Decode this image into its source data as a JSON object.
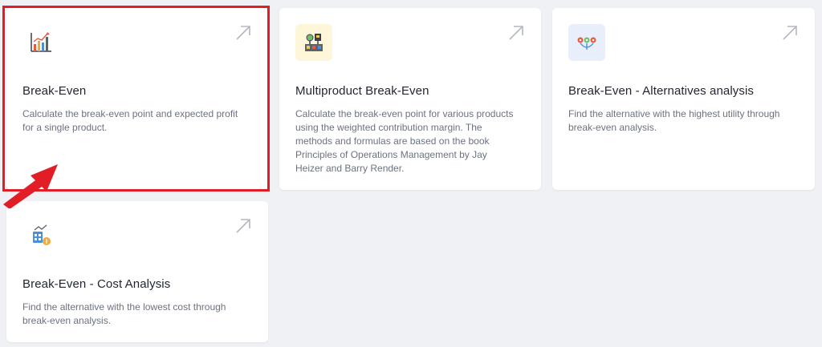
{
  "cards": [
    {
      "title": "Break-Even",
      "icon": "bar-chart-growth-icon",
      "desc": [
        "Calculate the break-even point and expected profit",
        "for a single product."
      ]
    },
    {
      "title": "Multiproduct Break-Even",
      "icon": "production-line-icon",
      "desc": [
        "Calculate the break-even point for various products",
        "using the weighted contribution margin. The",
        "methods and formulas are based on the book",
        "Principles of Operations Management by Jay",
        "Heizer and Barry Render."
      ]
    },
    {
      "title": "Break-Even - Alternatives analysis",
      "icon": "alternatives-icon",
      "desc": [
        "Find the alternative with the highest utility through",
        "break-even analysis."
      ]
    },
    {
      "title": "Break-Even - Cost Analysis",
      "icon": "cost-analysis-icon",
      "desc": [
        "Find the alternative with the lowest cost through",
        "break-even analysis."
      ]
    }
  ],
  "colors": {
    "highlight": "#e11d26",
    "background": "#f0f1f4",
    "card": "#ffffff"
  }
}
